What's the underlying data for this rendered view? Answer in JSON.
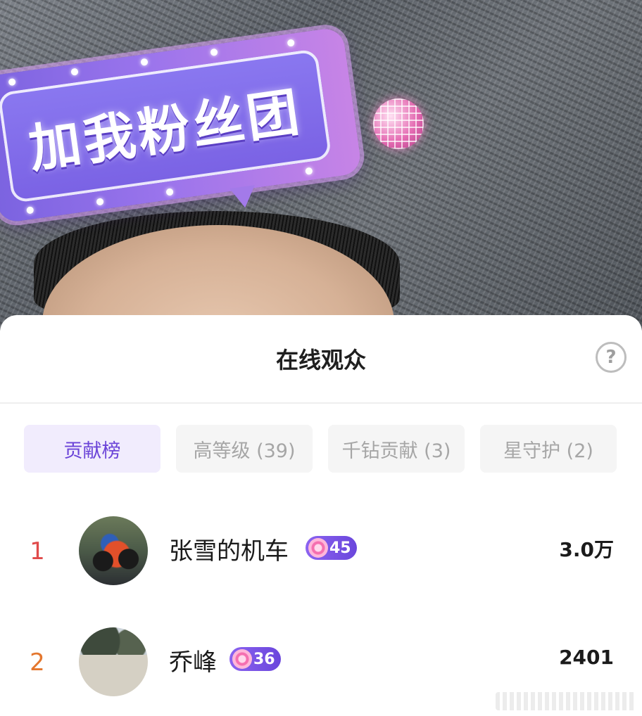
{
  "stream": {
    "sticker_text": "加我粉丝团"
  },
  "panel": {
    "title": "在线观众",
    "help_symbol": "?"
  },
  "tabs": [
    {
      "label": "贡献榜",
      "active": true
    },
    {
      "label": "高等级 (39)",
      "active": false
    },
    {
      "label": "千钻贡献 (3)",
      "active": false
    },
    {
      "label": "星守护 (2)",
      "active": false
    }
  ],
  "leaderboard": [
    {
      "rank": "1",
      "rank_color": "#e04a4a",
      "name": "张雪的机车",
      "level": "45",
      "amount": "3.0万"
    },
    {
      "rank": "2",
      "rank_color": "#e4772e",
      "name": "乔峰",
      "level": "36",
      "amount": "2401"
    }
  ],
  "colors": {
    "accent": "#6b44d8",
    "tab_active_bg": "#f1ecfd",
    "badge": "#7a55e6"
  }
}
